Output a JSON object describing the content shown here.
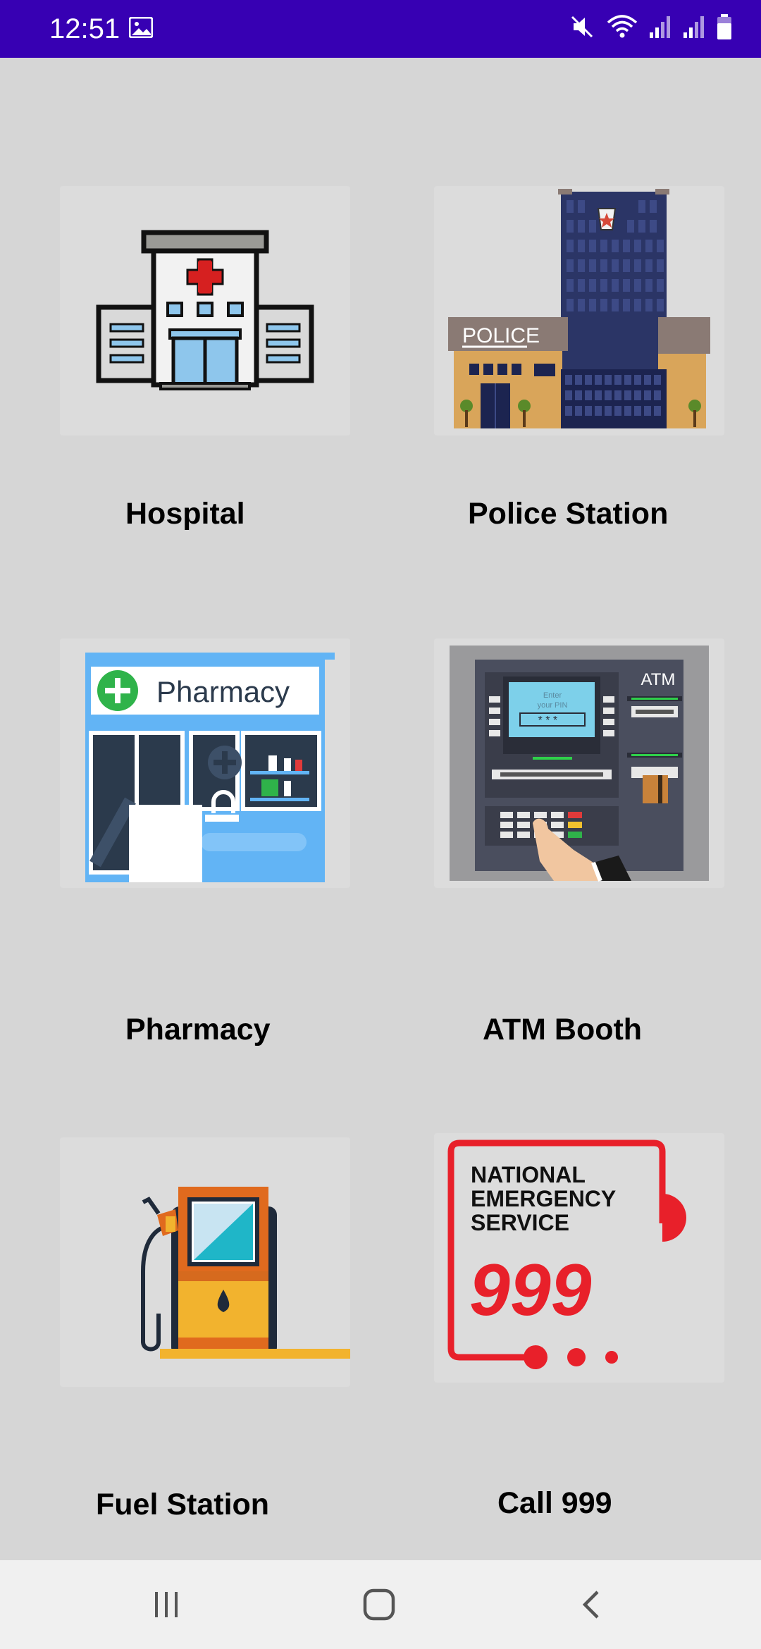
{
  "status_bar": {
    "time": "12:51",
    "icons": [
      "image-icon",
      "mute-icon",
      "wifi-icon",
      "signal-icon",
      "signal-icon",
      "battery-icon"
    ]
  },
  "cards": [
    {
      "label": "Hospital",
      "icon": "hospital-icon"
    },
    {
      "label": "Police Station",
      "icon": "police-station-icon"
    },
    {
      "label": "Pharmacy",
      "icon": "pharmacy-icon"
    },
    {
      "label": "ATM Booth",
      "icon": "atm-icon"
    },
    {
      "label": "Fuel Station",
      "icon": "fuel-pump-icon"
    },
    {
      "label": "Call 999",
      "icon": "emergency-999-icon"
    }
  ],
  "image_text": {
    "police_sign": "POLICE",
    "pharmacy_sign": "Pharmacy",
    "atm_sign": "ATM",
    "atm_screen_line1": "Enter",
    "atm_screen_line2": "your PIN",
    "atm_screen_pin": "* * * _",
    "emergency_line1": "NATIONAL",
    "emergency_line2": "EMERGENCY",
    "emergency_line3": "SERVICE",
    "emergency_number": "999"
  },
  "nav_bar": {
    "buttons": [
      "recent-apps-icon",
      "home-icon",
      "back-icon"
    ]
  },
  "colors": {
    "status_bar": "#3700b3",
    "background": "#d6d6d6",
    "emergency_red": "#e8202a"
  }
}
